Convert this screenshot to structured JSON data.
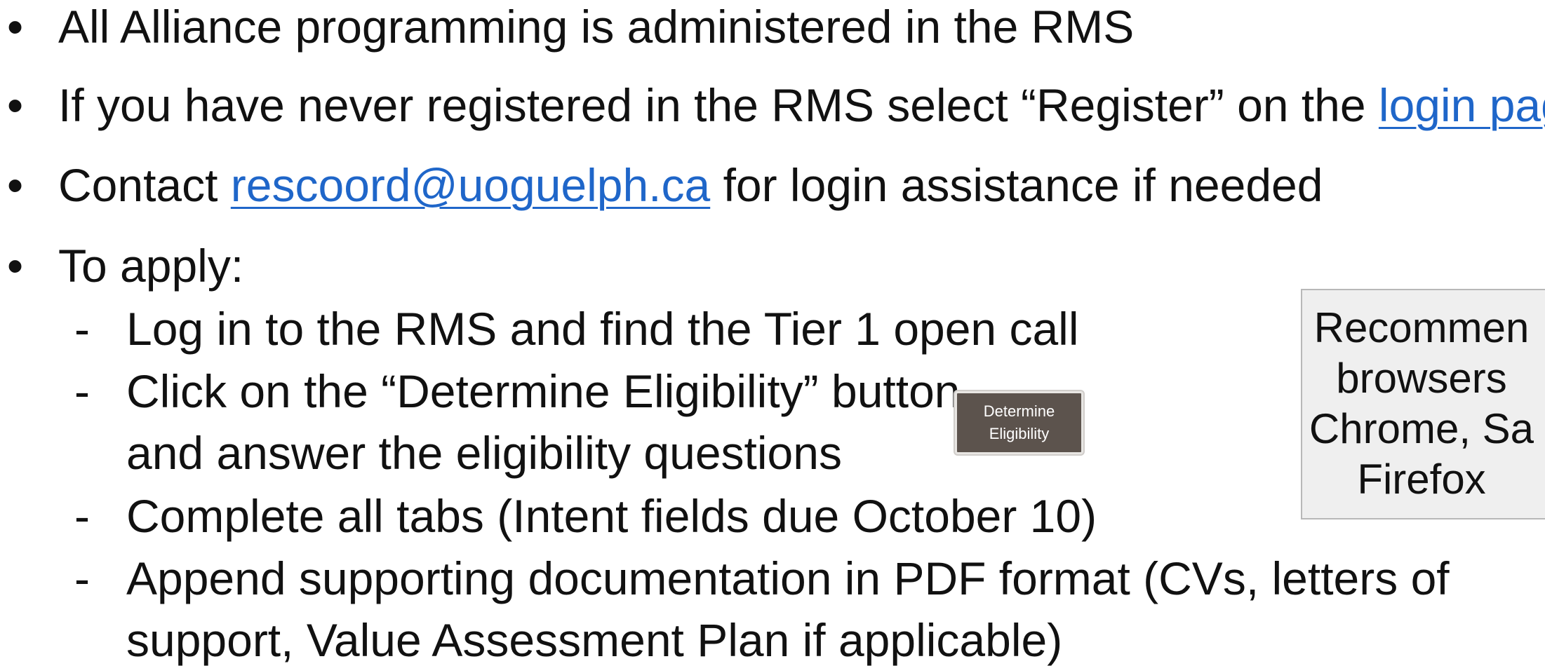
{
  "bullets": [
    {
      "text": "All Alliance programming is administered in the RMS"
    },
    {
      "text_before": "If you have never registered in the RMS select “Register” on the ",
      "link": "login page"
    },
    {
      "text_before": "Contact ",
      "link": "rescoord@uoguelph.ca",
      "text_after": " for login assistance if needed"
    },
    {
      "text": "To apply:"
    }
  ],
  "sub_items": [
    {
      "text": "Log in to the RMS and find the Tier 1 open call"
    },
    {
      "line1": "Click on the “Determine Eligibility” button",
      "line2": "and answer the eligibility questions"
    },
    {
      "text": "Complete all tabs (Intent fields due October 10)"
    },
    {
      "line1": "Append supporting documentation in PDF format (CVs, letters of",
      "line2": "support, Value Assessment Plan if applicable)"
    }
  ],
  "symbols": {
    "bullet": "•",
    "dash": "-"
  },
  "eligibility_button": {
    "label": "Determine\nEligibility"
  },
  "browser_note": {
    "text": "Recommen\nbrowsers\nChrome, Sa\nFirefox"
  },
  "colors": {
    "link": "#1f66c9",
    "button_bg": "#5c534d",
    "note_bg": "#efefef"
  }
}
